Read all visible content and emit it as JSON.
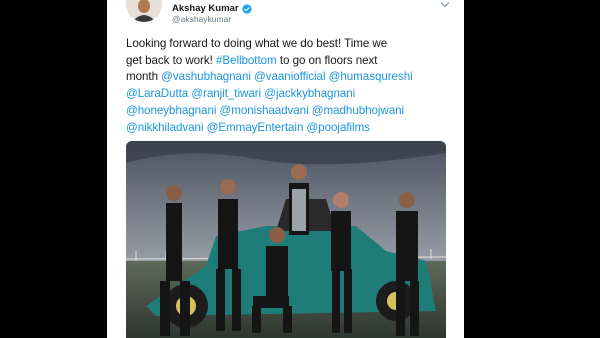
{
  "user": {
    "display_name": "Akshay Kumar",
    "handle": "@akshaykumar",
    "verified": true
  },
  "tweet": {
    "lines": [
      [
        {
          "text": "Looking forward to doing what we do best! Time we",
          "type": "text"
        }
      ],
      [
        {
          "text": "get back to work! ",
          "type": "text"
        },
        {
          "text": "#Bellbottom",
          "type": "link"
        },
        {
          "text": " to go on floors next",
          "type": "text"
        }
      ],
      [
        {
          "text": "month ",
          "type": "text"
        },
        {
          "text": "@vashubhagnani",
          "type": "link"
        },
        {
          "text": " ",
          "type": "text"
        },
        {
          "text": "@vaaniofficial",
          "type": "link"
        },
        {
          "text": " ",
          "type": "text"
        },
        {
          "text": "@humasqureshi",
          "type": "link"
        }
      ],
      [
        {
          "text": "@LaraDutta",
          "type": "link"
        },
        {
          "text": " ",
          "type": "text"
        },
        {
          "text": "@ranjit_tiwari",
          "type": "link"
        },
        {
          "text": " ",
          "type": "text"
        },
        {
          "text": "@jackkybhagnani",
          "type": "link"
        }
      ],
      [
        {
          "text": "@honeybhagnani",
          "type": "link"
        },
        {
          "text": " ",
          "type": "text"
        },
        {
          "text": "@monishaadvani",
          "type": "link"
        },
        {
          "text": " ",
          "type": "text"
        },
        {
          "text": "@madhubhojwani",
          "type": "link"
        }
      ],
      [
        {
          "text": "@nikkhiladvani",
          "type": "link"
        },
        {
          "text": " ",
          "type": "text"
        },
        {
          "text": "@EmmayEntertain",
          "type": "link"
        },
        {
          "text": " ",
          "type": "text"
        },
        {
          "text": "@poojafilms",
          "type": "link"
        }
      ]
    ]
  },
  "icons": {
    "verified": "verified-badge-icon",
    "menu": "chevron-down-icon"
  },
  "colors": {
    "link": "#1b95e0",
    "text": "#14171a",
    "secondary": "#657786",
    "verified": "#1da1f2"
  }
}
